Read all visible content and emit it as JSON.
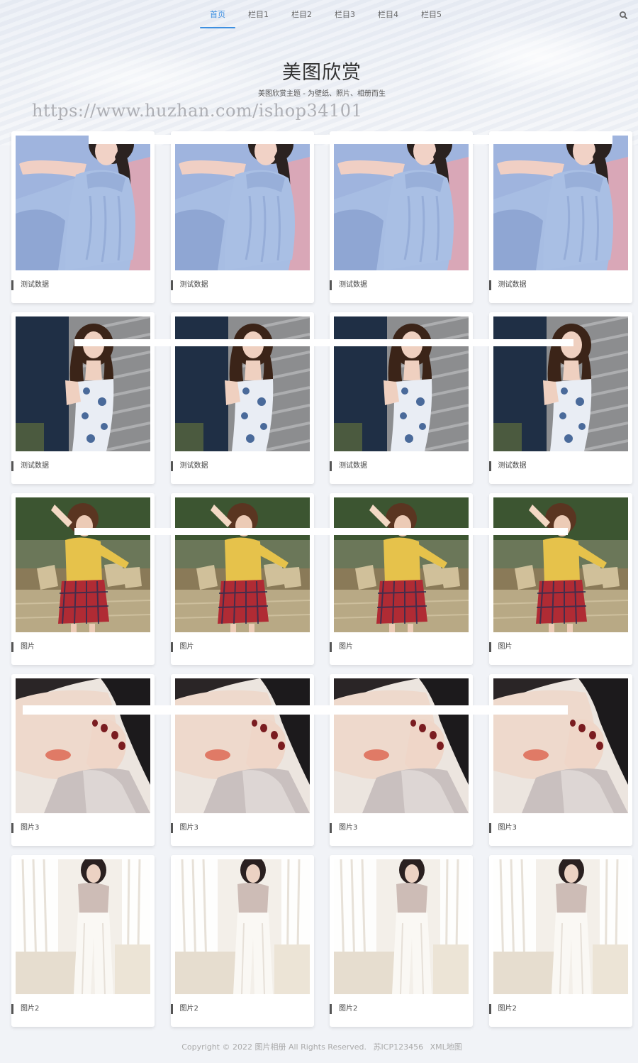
{
  "nav": {
    "items": [
      {
        "label": "首页",
        "active": true
      },
      {
        "label": "栏目1",
        "active": false
      },
      {
        "label": "栏目2",
        "active": false
      },
      {
        "label": "栏目3",
        "active": false
      },
      {
        "label": "栏目4",
        "active": false
      },
      {
        "label": "栏目5",
        "active": false
      }
    ],
    "search_icon": "search-icon"
  },
  "hero": {
    "title": "美图欣赏",
    "subtitle": "美图欣赏主题 - 为壁纸、照片、相册而生",
    "watermark": "https://www.huzhan.com/ishop34101"
  },
  "gallery": {
    "rows": [
      {
        "photo": "woman-blue-knit-sweater",
        "items": [
          "测试数据",
          "测试数据",
          "测试数据",
          "测试数据"
        ]
      },
      {
        "photo": "woman-floral-dress-wall",
        "items": [
          "测试数据",
          "测试数据",
          "测试数据",
          "测试数据"
        ]
      },
      {
        "photo": "woman-yellow-top-plaid-skirt",
        "items": [
          "图片",
          "图片",
          "图片",
          "图片"
        ]
      },
      {
        "photo": "woman-closeup-hand-face",
        "items": [
          "图片3",
          "图片3",
          "图片3",
          "图片3"
        ]
      },
      {
        "photo": "woman-white-pants-curtain",
        "items": [
          "图片2",
          "图片2",
          "图片2",
          "图片2"
        ]
      }
    ]
  },
  "footer": {
    "copyright": "Copyright © 2022 图片相册 All Rights Reserved.",
    "icp": "苏ICP123456",
    "sitemap": "XML地图"
  },
  "colors": {
    "accent": "#3d8fe0",
    "background": "#f1f3f7",
    "card": "#ffffff"
  }
}
